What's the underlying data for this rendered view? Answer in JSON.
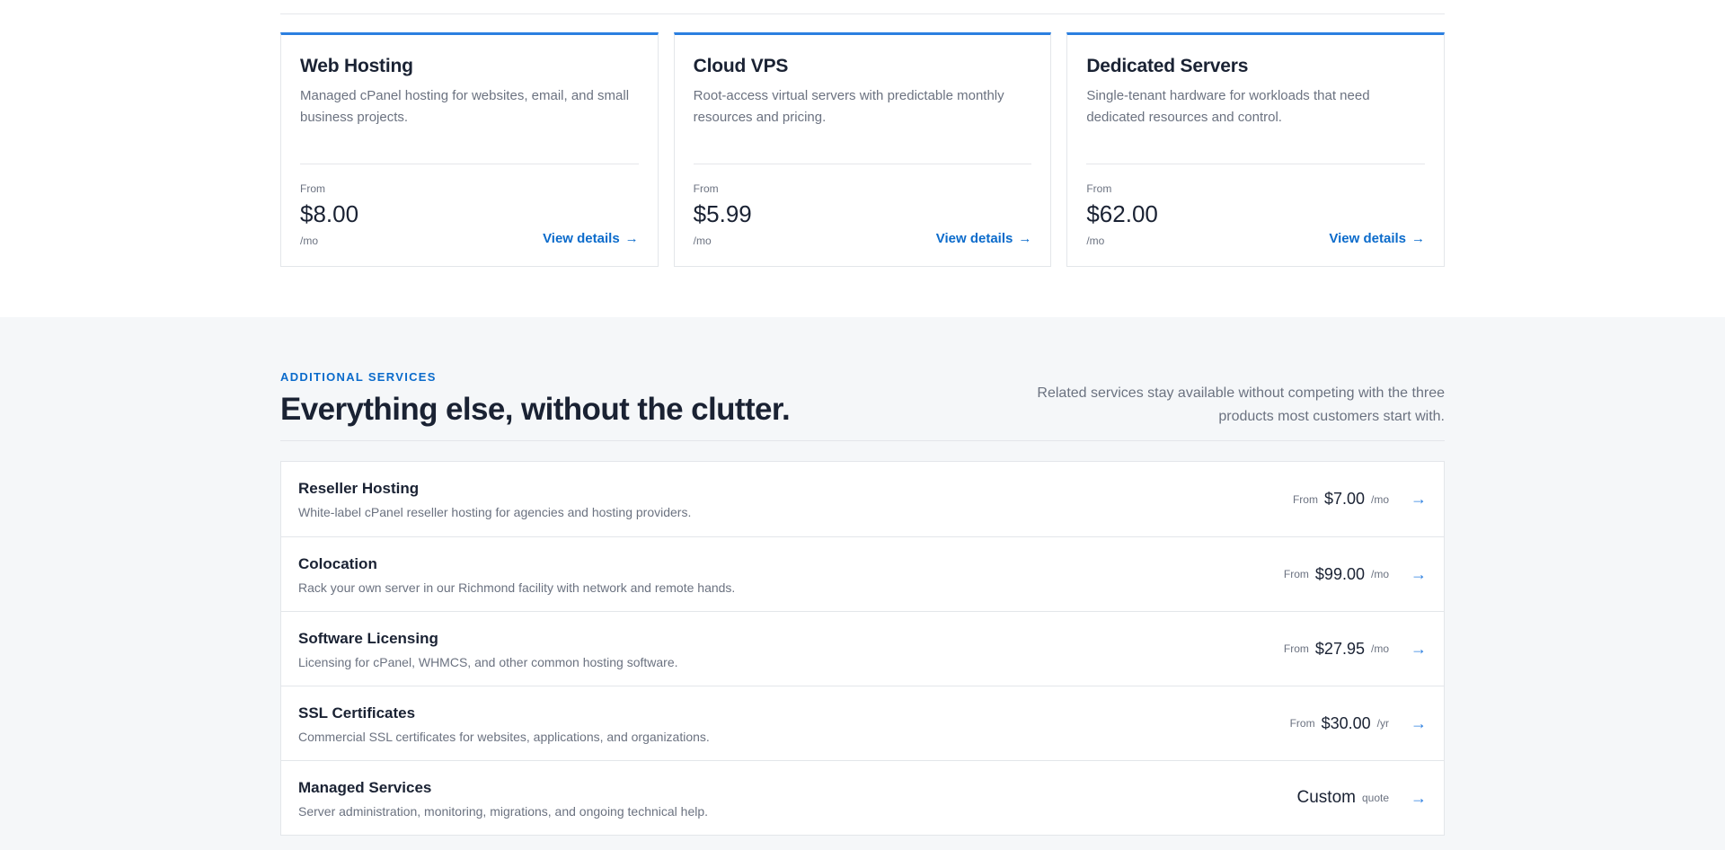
{
  "plans": [
    {
      "title": "Web Hosting",
      "description": "Managed cPanel hosting for websites, email, and small business projects.",
      "from_label": "From",
      "price": "$8.00",
      "unit": "/mo",
      "link_label": "View details",
      "arrow": "→"
    },
    {
      "title": "Cloud VPS",
      "description": "Root-access virtual servers with predictable monthly resources and pricing.",
      "from_label": "From",
      "price": "$5.99",
      "unit": "/mo",
      "link_label": "View details",
      "arrow": "→"
    },
    {
      "title": "Dedicated Servers",
      "description": "Single-tenant hardware for workloads that need dedicated resources and control.",
      "from_label": "From",
      "price": "$62.00",
      "unit": "/mo",
      "link_label": "View details",
      "arrow": "→"
    }
  ],
  "additional": {
    "eyebrow": "ADDITIONAL SERVICES",
    "title": "Everything else, without the clutter.",
    "subtitle": "Related services stay available without competing with the three products most customers start with.",
    "services": [
      {
        "name": "Reseller Hosting",
        "description": "White-label cPanel reseller hosting for agencies and hosting providers.",
        "from_label": "From",
        "price": "$7.00",
        "unit": "/mo",
        "arrow": "→"
      },
      {
        "name": "Colocation",
        "description": "Rack your own server in our Richmond facility with network and remote hands.",
        "from_label": "From",
        "price": "$99.00",
        "unit": "/mo",
        "arrow": "→"
      },
      {
        "name": "Software Licensing",
        "description": "Licensing for cPanel, WHMCS, and other common hosting software.",
        "from_label": "From",
        "price": "$27.95",
        "unit": "/mo",
        "arrow": "→"
      },
      {
        "name": "SSL Certificates",
        "description": "Commercial SSL certificates for websites, applications, and organizations.",
        "from_label": "From",
        "price": "$30.00",
        "unit": "/yr",
        "arrow": "→"
      },
      {
        "name": "Managed Services",
        "description": "Server administration, monitoring, migrations, and ongoing technical help.",
        "from_label": "",
        "price": "Custom",
        "unit": "quote",
        "arrow": "→"
      }
    ]
  },
  "colors": {
    "accent": "#2b7fe0",
    "link": "#0b6bcb",
    "heading": "#1a2233",
    "muted": "#6b7280",
    "section_bg": "#f5f7f9"
  }
}
